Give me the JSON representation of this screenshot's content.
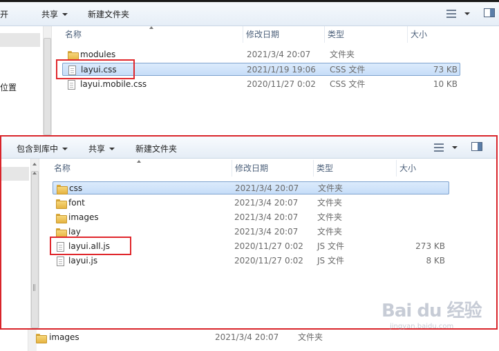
{
  "window_top": {
    "toolbar": {
      "partial_left": "开",
      "share_label": "共享",
      "new_folder_label": "新建文件夹"
    },
    "nav_partial_text": "位置",
    "columns": {
      "name": "名称",
      "date": "修改日期",
      "type": "类型",
      "size": "大小"
    },
    "rows": [
      {
        "name": "modules",
        "date": "2021/3/4 20:07",
        "type": "文件夹",
        "size": "",
        "icon": "folder-icon"
      },
      {
        "name": "layui.css",
        "date": "2021/1/19 19:06",
        "type": "CSS 文件",
        "size": "73 KB",
        "icon": "file-icon",
        "selected": true,
        "highlighted": true
      },
      {
        "name": "layui.mobile.css",
        "date": "2020/11/27 0:02",
        "type": "CSS 文件",
        "size": "10 KB",
        "icon": "file-icon"
      }
    ]
  },
  "window_front": {
    "toolbar": {
      "include_library_label": "包含到库中",
      "share_label": "共享",
      "new_folder_label": "新建文件夹"
    },
    "columns": {
      "name": "名称",
      "date": "修改日期",
      "type": "类型",
      "size": "大小"
    },
    "rows": [
      {
        "name": "css",
        "date": "2021/3/4 20:07",
        "type": "文件夹",
        "size": "",
        "icon": "folder-icon",
        "selected": true
      },
      {
        "name": "font",
        "date": "2021/3/4 20:07",
        "type": "文件夹",
        "size": "",
        "icon": "folder-icon"
      },
      {
        "name": "images",
        "date": "2021/3/4 20:07",
        "type": "文件夹",
        "size": "",
        "icon": "folder-icon"
      },
      {
        "name": "lay",
        "date": "2021/3/4 20:07",
        "type": "文件夹",
        "size": "",
        "icon": "folder-icon"
      },
      {
        "name": "layui.all.js",
        "date": "2020/11/27 0:02",
        "type": "JS 文件",
        "size": "273 KB",
        "icon": "file-icon",
        "highlighted": true
      },
      {
        "name": "layui.js",
        "date": "2020/11/27 0:02",
        "type": "JS 文件",
        "size": "8 KB",
        "icon": "file-icon"
      }
    ]
  },
  "window_bottom": {
    "rows": [
      {
        "name": "images",
        "date": "2021/3/4 20:07",
        "type": "文件夹",
        "icon": "folder-icon"
      }
    ]
  },
  "watermark": {
    "text": "Bai du 经验",
    "sub": "jingyan.baidu.com"
  },
  "colors": {
    "highlight": "#e0262b",
    "selection": "#c6ddf8",
    "header_text": "#4c607a"
  }
}
